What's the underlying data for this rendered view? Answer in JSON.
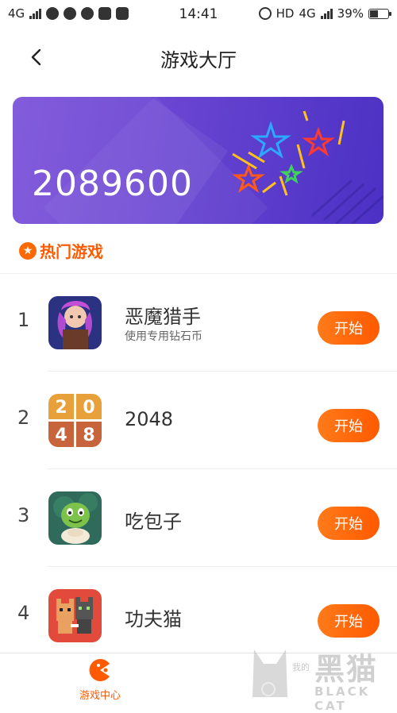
{
  "status_bar": {
    "network_left": "4G",
    "time": "14:41",
    "hd": "HD",
    "network_right": "4G",
    "battery": "39%",
    "icons": [
      "signal-icon",
      "vpn-icon",
      "chat-icon",
      "chat-icon",
      "mail-icon",
      "s-app-icon",
      "alarm-icon",
      "battery-icon"
    ]
  },
  "navbar": {
    "title": "游戏大厅"
  },
  "balance_card": {
    "amount": "2089600"
  },
  "hot_section": {
    "badge": "★",
    "label": "热门游戏"
  },
  "games": [
    {
      "rank": "1",
      "name": "恶魔猎手",
      "subtitle": "使用专用钻石币",
      "button": "开始",
      "icon": "demon-hunter-icon"
    },
    {
      "rank": "2",
      "name": "2048",
      "subtitle": "",
      "button": "开始",
      "icon": "2048-icon"
    },
    {
      "rank": "3",
      "name": "吃包子",
      "subtitle": "",
      "button": "开始",
      "icon": "eat-bun-icon"
    },
    {
      "rank": "4",
      "name": "功夫猫",
      "subtitle": "",
      "button": "开始",
      "icon": "kungfu-cat-icon"
    }
  ],
  "tile_2048": [
    "2",
    "0",
    "4",
    "8"
  ],
  "tabbar": {
    "tab_label": "游戏中心"
  },
  "watermark": {
    "cn": "黑猫",
    "en": "BLACK CAT",
    "sub": "我的"
  },
  "colors": {
    "accent": "#ff5a00",
    "card_start": "#7b52d9",
    "card_end": "#4b31c4"
  }
}
